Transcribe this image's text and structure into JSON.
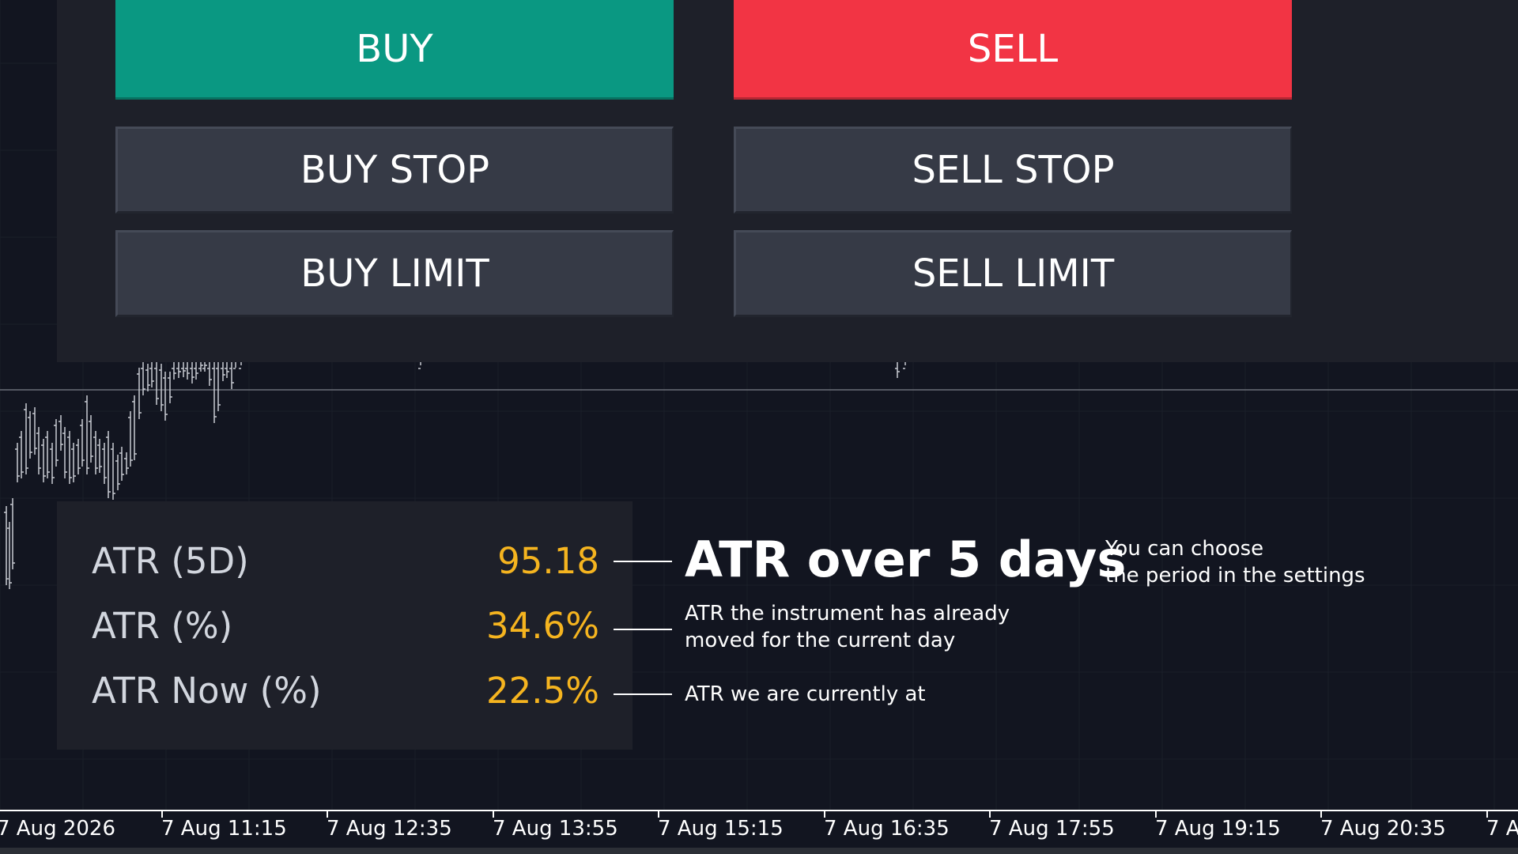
{
  "trade_panel": {
    "buy_label": "BUY",
    "sell_label": "SELL",
    "buy_stop_label": "BUY STOP",
    "sell_stop_label": "SELL STOP",
    "buy_limit_label": "BUY LIMIT",
    "sell_limit_label": "SELL LIMIT"
  },
  "atr_panel": {
    "rows": [
      {
        "label": "ATR (5D)",
        "value": "95.18"
      },
      {
        "label": "ATR (%)",
        "value": "34.6%"
      },
      {
        "label": "ATR Now (%)",
        "value": "22.5%"
      }
    ]
  },
  "annotations": {
    "atr_5d_title": "ATR over 5 days",
    "atr_5d_note_line1": "You can choose",
    "atr_5d_note_line2": "the period in the settings",
    "atr_percent_line1": "ATR the instrument has already",
    "atr_percent_line2": "moved for the current day",
    "atr_now_text": "ATR we are currently at"
  },
  "time_axis": {
    "labels": [
      "7 Aug 2026",
      "7 Aug 11:15",
      "7 Aug 12:35",
      "7 Aug 13:55",
      "7 Aug 15:15",
      "7 Aug 16:35",
      "7 Aug 17:55",
      "7 Aug 19:15",
      "7 Aug 20:35",
      "7 A"
    ]
  },
  "colors": {
    "buy": "#0a9882",
    "sell": "#f23444",
    "atr_value": "#f5b41f",
    "background": "#121520",
    "panel": "#1e2029"
  }
}
